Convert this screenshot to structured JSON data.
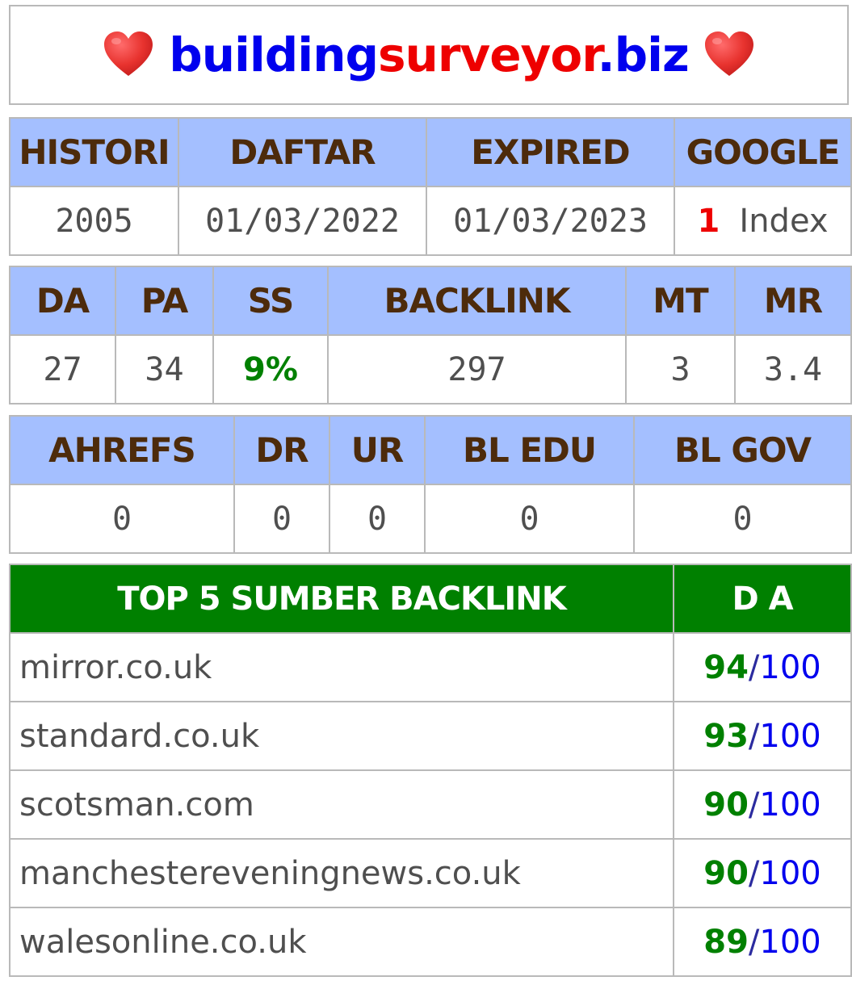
{
  "title": {
    "part1": "building",
    "part2": "surveyor",
    "part3": ".biz",
    "left_icon": "heart-icon",
    "right_icon": "heart-icon"
  },
  "colors": {
    "header_bg": "#a4bfff",
    "header_text": "#4d2b0b",
    "top_header_bg": "#008000",
    "link_blue": "#0000ee",
    "accent_red": "#ee0000",
    "accent_green": "#008000"
  },
  "table1": {
    "headers": [
      "HISTORI",
      "DAFTAR",
      "EXPIRED",
      "GOOGLE"
    ],
    "histori": "2005",
    "daftar": "01/03/2022",
    "expired": "01/03/2023",
    "google_count": "1",
    "google_label": "Index"
  },
  "table2": {
    "headers": [
      "DA",
      "PA",
      "SS",
      "BACKLINK",
      "MT",
      "MR"
    ],
    "values": [
      "27",
      "34",
      "9%",
      "297",
      "3",
      "3.4"
    ]
  },
  "table3": {
    "headers": [
      "AHREFS",
      "DR",
      "UR",
      "BL EDU",
      "BL GOV"
    ],
    "values": [
      "0",
      "0",
      "0",
      "0",
      "0"
    ]
  },
  "top_backlinks": {
    "header_source": "TOP 5 SUMBER BACKLINK",
    "header_da": "D A",
    "separator": "/",
    "max": "100",
    "rows": [
      {
        "domain": "mirror.co.uk",
        "da": "94"
      },
      {
        "domain": "standard.co.uk",
        "da": "93"
      },
      {
        "domain": "scotsman.com",
        "da": "90"
      },
      {
        "domain": "manchestereveningnews.co.uk",
        "da": "90"
      },
      {
        "domain": "walesonline.co.uk",
        "da": "89"
      }
    ]
  }
}
